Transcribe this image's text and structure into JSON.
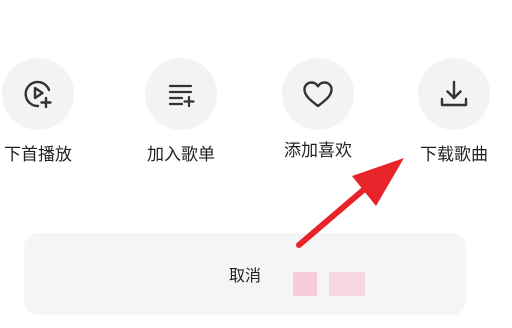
{
  "actions": [
    {
      "label": "下首播放",
      "icon": "play-next-icon"
    },
    {
      "label": "加入歌单",
      "icon": "add-to-playlist-icon"
    },
    {
      "label": "添加喜欢",
      "icon": "heart-icon"
    },
    {
      "label": "下载歌曲",
      "icon": "download-icon"
    }
  ],
  "cancel": {
    "label": "取消"
  },
  "colors": {
    "icon_stroke": "#333333",
    "icon_bg": "#f2f3f5",
    "cancel_bg": "#f4f5f7",
    "annotation_arrow": "#e8242b"
  }
}
